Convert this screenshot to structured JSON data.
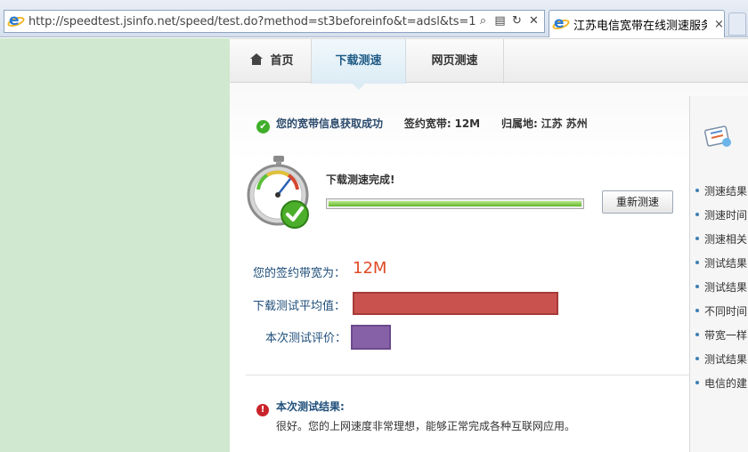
{
  "browser": {
    "url": "http://speedtest.jsinfo.net/speed/test.do?method=st3beforeinfo&t=adsl&ts=1",
    "tab_title": "江苏电信宽带在线测速服务...",
    "tab_close": "×",
    "tools": {
      "search": "⌕",
      "compat": "▤",
      "refresh": "↻",
      "stop": "✕"
    }
  },
  "nav": {
    "home": "首页",
    "download_test": "下载测速",
    "web_test": "网页测速"
  },
  "info": {
    "status": "您的宽带信息获取成功",
    "plan_label": "签约宽带:",
    "plan_value": "12M",
    "location_label": "归属地:",
    "location_value": "江苏 苏州"
  },
  "test": {
    "complete_text": "下载测速完成!",
    "progress": 1.0,
    "retest_button": "重新测速"
  },
  "results": {
    "bandwidth_label": "您的签约带宽为：",
    "bandwidth_value": "12M",
    "avg_label": "下载测试平均值：",
    "avg_bar_fraction": 0.82,
    "rating_label": "本次测试评价：",
    "rating_bar_fraction": 0.16,
    "colors": {
      "avg_bar": "#c9524f",
      "rating_bar": "#8761a8"
    }
  },
  "conclusion": {
    "title": "本次测试结果:",
    "text": "很好。您的上网速度非常理想，能够正常完成各种互联网应用。"
  },
  "sidebar": {
    "items": [
      "测速结果",
      "测速时间",
      "测速相关",
      "测试结果",
      "测试结果",
      "不同时间",
      "带宽一样",
      "测试结果",
      "电信的建"
    ]
  }
}
